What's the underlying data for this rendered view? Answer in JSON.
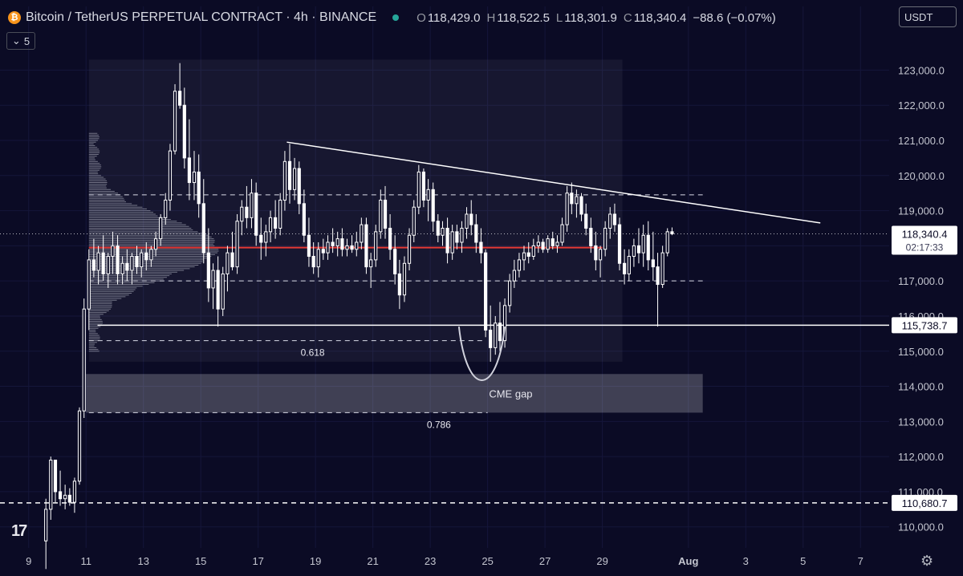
{
  "header": {
    "title": "Bitcoin / TetherUS PERPETUAL CONTRACT · 4h · BINANCE",
    "coin_glyph": "₿",
    "open_label": "O",
    "open": "118,429.0",
    "high_label": "H",
    "high": "118,522.5",
    "low_label": "L",
    "low": "118,301.9",
    "close_label": "C",
    "close": "118,340.4",
    "change": "−88.6 (−0.07%)"
  },
  "currency": "USDT",
  "indicators_count": "5",
  "logo_text": "17",
  "colors": {
    "background": "#0b0b25",
    "candle": "#ffffff",
    "poc_line": "#e53935",
    "live": "#26a69a"
  },
  "chart_data": {
    "type": "candlestick",
    "y_axis": {
      "ylim": [
        109400,
        123900
      ],
      "ticks": [
        123000,
        122000,
        121000,
        120000,
        119000,
        118000,
        117000,
        116000,
        115000,
        114000,
        113000,
        112000,
        111000,
        110000
      ],
      "tick_labels": [
        "123,000.0",
        "122,000.0",
        "121,000.0",
        "120,000.0",
        "119,000.0",
        "118,000.0",
        "117,000.0",
        "116,000.0",
        "115,000.0",
        "114,000.0",
        "113,000.0",
        "112,000.0",
        "111,000.0",
        "110,000.0"
      ]
    },
    "x_axis": {
      "xlim": [
        "Jul 8",
        "Aug 8"
      ],
      "ticks": [
        "Jul 9",
        "Jul 11",
        "Jul 13",
        "Jul 15",
        "Jul 17",
        "Jul 19",
        "Jul 21",
        "Jul 23",
        "Jul 25",
        "Jul 27",
        "Jul 29",
        "Aug 1",
        "Aug 3",
        "Aug 5",
        "Aug 7"
      ],
      "tick_labels": [
        "9",
        "11",
        "13",
        "15",
        "17",
        "19",
        "21",
        "23",
        "25",
        "27",
        "29",
        "Aug",
        "3",
        "5",
        "7"
      ]
    },
    "price_labels": [
      {
        "value": 118340.4,
        "text": "118,340.4",
        "countdown": "02:17:33"
      },
      {
        "value": 115738.7,
        "text": "115,738.7"
      },
      {
        "value": 110680.7,
        "text": "110,680.7"
      }
    ],
    "levels": [
      {
        "value": 117950,
        "style": "poc"
      },
      {
        "value": 119450,
        "style": "dashed"
      },
      {
        "value": 117000,
        "style": "dashed"
      },
      {
        "value": 115738.7,
        "style": "solid"
      },
      {
        "value": 115300,
        "style": "dashed",
        "label": "0.618"
      },
      {
        "value": 113250,
        "style": "dashed",
        "label": "0.786"
      },
      {
        "value": 110680.7,
        "style": "dashed"
      }
    ],
    "trendline": [
      {
        "x": "Jul 18",
        "y": 120950
      },
      {
        "x": "Aug 5.6",
        "y": 118650
      }
    ],
    "range_box": {
      "x0": "Jul 11.1",
      "x1": "Jul 29.7",
      "y0": 114700,
      "y1": 123300
    },
    "zones": [
      {
        "label": "CME gap",
        "x0": "Jul 11",
        "x1": "Aug 1.5",
        "y0": 113250,
        "y1": 114350
      }
    ],
    "curve": {
      "from": "Jul 24",
      "to": "Jul 25.6",
      "top": 115700,
      "bottom": 114350
    },
    "volume_profile": {
      "y_min": 115000,
      "y_max": 121200
    },
    "candles": [
      {
        "t": "Jul 9.6",
        "o": 109600,
        "h": 110800,
        "l": 108800,
        "c": 110500
      },
      {
        "t": "Jul 9.77",
        "o": 110500,
        "h": 112000,
        "l": 110200,
        "c": 111900
      },
      {
        "t": "Jul 9.93",
        "o": 111900,
        "h": 111900,
        "l": 110700,
        "c": 111000
      },
      {
        "t": "Jul 10.1",
        "o": 111000,
        "h": 111600,
        "l": 110600,
        "c": 110800
      },
      {
        "t": "Jul 10.27",
        "o": 110800,
        "h": 111200,
        "l": 110500,
        "c": 110900
      },
      {
        "t": "Jul 10.43",
        "o": 110900,
        "h": 111100,
        "l": 110600,
        "c": 110700
      },
      {
        "t": "Jul 10.6",
        "o": 110700,
        "h": 111400,
        "l": 110400,
        "c": 111300
      },
      {
        "t": "Jul 10.77",
        "o": 111300,
        "h": 113400,
        "l": 111200,
        "c": 113300
      },
      {
        "t": "Jul 10.93",
        "o": 113300,
        "h": 116500,
        "l": 113100,
        "c": 116200
      },
      {
        "t": "Jul 11.1",
        "o": 116200,
        "h": 117900,
        "l": 115600,
        "c": 117600
      },
      {
        "t": "Jul 11.27",
        "o": 117600,
        "h": 118200,
        "l": 117100,
        "c": 117300
      },
      {
        "t": "Jul 11.43",
        "o": 117300,
        "h": 118000,
        "l": 116900,
        "c": 117800
      },
      {
        "t": "Jul 11.6",
        "o": 117800,
        "h": 118300,
        "l": 117000,
        "c": 117200
      },
      {
        "t": "Jul 11.77",
        "o": 117200,
        "h": 117800,
        "l": 116800,
        "c": 117700
      },
      {
        "t": "Jul 11.93",
        "o": 117700,
        "h": 118400,
        "l": 117200,
        "c": 118000
      },
      {
        "t": "Jul 12.1",
        "o": 118000,
        "h": 118300,
        "l": 116900,
        "c": 117200
      },
      {
        "t": "Jul 12.27",
        "o": 117200,
        "h": 117700,
        "l": 116900,
        "c": 117500
      },
      {
        "t": "Jul 12.43",
        "o": 117500,
        "h": 117900,
        "l": 117000,
        "c": 117300
      },
      {
        "t": "Jul 12.6",
        "o": 117300,
        "h": 117800,
        "l": 116900,
        "c": 117700
      },
      {
        "t": "Jul 12.77",
        "o": 117700,
        "h": 118000,
        "l": 117200,
        "c": 117400
      },
      {
        "t": "Jul 12.93",
        "o": 117400,
        "h": 117900,
        "l": 117100,
        "c": 117800
      },
      {
        "t": "Jul 13.1",
        "o": 117800,
        "h": 118100,
        "l": 117300,
        "c": 117600
      },
      {
        "t": "Jul 13.27",
        "o": 117600,
        "h": 118000,
        "l": 117400,
        "c": 117900
      },
      {
        "t": "Jul 13.43",
        "o": 117900,
        "h": 118400,
        "l": 117700,
        "c": 118200
      },
      {
        "t": "Jul 13.6",
        "o": 118200,
        "h": 118900,
        "l": 118000,
        "c": 118800
      },
      {
        "t": "Jul 13.77",
        "o": 118800,
        "h": 119500,
        "l": 118600,
        "c": 119300
      },
      {
        "t": "Jul 13.93",
        "o": 119300,
        "h": 120900,
        "l": 119000,
        "c": 120700
      },
      {
        "t": "Jul 14.1",
        "o": 120700,
        "h": 122600,
        "l": 120600,
        "c": 122400
      },
      {
        "t": "Jul 14.27",
        "o": 122400,
        "h": 123200,
        "l": 121900,
        "c": 122000
      },
      {
        "t": "Jul 14.43",
        "o": 122000,
        "h": 122500,
        "l": 120200,
        "c": 120500
      },
      {
        "t": "Jul 14.6",
        "o": 120500,
        "h": 121600,
        "l": 119300,
        "c": 119800
      },
      {
        "t": "Jul 14.77",
        "o": 119800,
        "h": 120700,
        "l": 119300,
        "c": 120100
      },
      {
        "t": "Jul 14.93",
        "o": 120100,
        "h": 120600,
        "l": 118800,
        "c": 119200
      },
      {
        "t": "Jul 15.1",
        "o": 119200,
        "h": 119900,
        "l": 117500,
        "c": 117800
      },
      {
        "t": "Jul 15.27",
        "o": 117800,
        "h": 118500,
        "l": 116400,
        "c": 116800
      },
      {
        "t": "Jul 15.43",
        "o": 116800,
        "h": 117500,
        "l": 116200,
        "c": 117300
      },
      {
        "t": "Jul 15.6",
        "o": 117300,
        "h": 117700,
        "l": 115700,
        "c": 116200
      },
      {
        "t": "Jul 15.77",
        "o": 116200,
        "h": 117400,
        "l": 116000,
        "c": 117200
      },
      {
        "t": "Jul 15.93",
        "o": 117200,
        "h": 118000,
        "l": 116700,
        "c": 117800
      },
      {
        "t": "Jul 16.1",
        "o": 117800,
        "h": 118400,
        "l": 117300,
        "c": 117400
      },
      {
        "t": "Jul 16.27",
        "o": 117400,
        "h": 118900,
        "l": 117200,
        "c": 118700
      },
      {
        "t": "Jul 16.43",
        "o": 118700,
        "h": 119300,
        "l": 118300,
        "c": 119100
      },
      {
        "t": "Jul 16.6",
        "o": 119100,
        "h": 119700,
        "l": 118500,
        "c": 118800
      },
      {
        "t": "Jul 16.77",
        "o": 118800,
        "h": 119900,
        "l": 118500,
        "c": 119500
      },
      {
        "t": "Jul 16.93",
        "o": 119500,
        "h": 119800,
        "l": 118000,
        "c": 118300
      },
      {
        "t": "Jul 17.1",
        "o": 118300,
        "h": 118800,
        "l": 117600,
        "c": 118100
      },
      {
        "t": "Jul 17.27",
        "o": 118100,
        "h": 118600,
        "l": 117700,
        "c": 118400
      },
      {
        "t": "Jul 17.43",
        "o": 118400,
        "h": 119000,
        "l": 118100,
        "c": 118800
      },
      {
        "t": "Jul 17.6",
        "o": 118800,
        "h": 119300,
        "l": 118200,
        "c": 118500
      },
      {
        "t": "Jul 17.77",
        "o": 118500,
        "h": 119500,
        "l": 118300,
        "c": 119300
      },
      {
        "t": "Jul 17.93",
        "o": 119300,
        "h": 120700,
        "l": 119000,
        "c": 120400
      },
      {
        "t": "Jul 18.1",
        "o": 120400,
        "h": 120900,
        "l": 119200,
        "c": 119600
      },
      {
        "t": "Jul 18.27",
        "o": 119600,
        "h": 120500,
        "l": 119300,
        "c": 120200
      },
      {
        "t": "Jul 18.43",
        "o": 120200,
        "h": 120400,
        "l": 118900,
        "c": 119200
      },
      {
        "t": "Jul 18.6",
        "o": 119200,
        "h": 119600,
        "l": 118100,
        "c": 118300
      },
      {
        "t": "Jul 18.77",
        "o": 118300,
        "h": 118800,
        "l": 117400,
        "c": 117700
      },
      {
        "t": "Jul 18.93",
        "o": 117700,
        "h": 118100,
        "l": 117200,
        "c": 117400
      },
      {
        "t": "Jul 19.1",
        "o": 117400,
        "h": 118100,
        "l": 117100,
        "c": 117900
      },
      {
        "t": "Jul 19.27",
        "o": 117900,
        "h": 118200,
        "l": 117600,
        "c": 117800
      },
      {
        "t": "Jul 19.43",
        "o": 117800,
        "h": 118300,
        "l": 117600,
        "c": 118100
      },
      {
        "t": "Jul 19.6",
        "o": 118100,
        "h": 118500,
        "l": 117800,
        "c": 118000
      },
      {
        "t": "Jul 19.77",
        "o": 118000,
        "h": 118400,
        "l": 117700,
        "c": 118200
      },
      {
        "t": "Jul 19.93",
        "o": 118200,
        "h": 118500,
        "l": 117700,
        "c": 117900
      },
      {
        "t": "Jul 20.1",
        "o": 117900,
        "h": 118200,
        "l": 117700,
        "c": 118000
      },
      {
        "t": "Jul 20.27",
        "o": 118000,
        "h": 118300,
        "l": 117800,
        "c": 117900
      },
      {
        "t": "Jul 20.43",
        "o": 117900,
        "h": 118400,
        "l": 117700,
        "c": 118100
      },
      {
        "t": "Jul 20.6",
        "o": 118100,
        "h": 118800,
        "l": 117900,
        "c": 118600
      },
      {
        "t": "Jul 20.77",
        "o": 118600,
        "h": 118800,
        "l": 117200,
        "c": 117400
      },
      {
        "t": "Jul 20.93",
        "o": 117400,
        "h": 117800,
        "l": 116800,
        "c": 117600
      },
      {
        "t": "Jul 21.1",
        "o": 117600,
        "h": 118600,
        "l": 117400,
        "c": 118400
      },
      {
        "t": "Jul 21.27",
        "o": 118400,
        "h": 119600,
        "l": 118200,
        "c": 119300
      },
      {
        "t": "Jul 21.43",
        "o": 119300,
        "h": 119700,
        "l": 118200,
        "c": 118500
      },
      {
        "t": "Jul 21.6",
        "o": 118500,
        "h": 118900,
        "l": 117600,
        "c": 117900
      },
      {
        "t": "Jul 21.77",
        "o": 117900,
        "h": 118300,
        "l": 116900,
        "c": 117200
      },
      {
        "t": "Jul 21.93",
        "o": 117200,
        "h": 117600,
        "l": 116200,
        "c": 116600
      },
      {
        "t": "Jul 22.1",
        "o": 116600,
        "h": 117700,
        "l": 116400,
        "c": 117500
      },
      {
        "t": "Jul 22.27",
        "o": 117500,
        "h": 118500,
        "l": 117300,
        "c": 118300
      },
      {
        "t": "Jul 22.43",
        "o": 118300,
        "h": 119300,
        "l": 118100,
        "c": 119100
      },
      {
        "t": "Jul 22.6",
        "o": 119100,
        "h": 120300,
        "l": 118900,
        "c": 120100
      },
      {
        "t": "Jul 22.77",
        "o": 120100,
        "h": 120200,
        "l": 119100,
        "c": 119300
      },
      {
        "t": "Jul 22.93",
        "o": 119300,
        "h": 119900,
        "l": 118700,
        "c": 119600
      },
      {
        "t": "Jul 23.1",
        "o": 119600,
        "h": 119800,
        "l": 118400,
        "c": 118700
      },
      {
        "t": "Jul 23.27",
        "o": 118700,
        "h": 118900,
        "l": 118100,
        "c": 118300
      },
      {
        "t": "Jul 23.43",
        "o": 118300,
        "h": 118700,
        "l": 118000,
        "c": 118500
      },
      {
        "t": "Jul 23.6",
        "o": 118500,
        "h": 118800,
        "l": 117500,
        "c": 117800
      },
      {
        "t": "Jul 23.77",
        "o": 117800,
        "h": 118600,
        "l": 117600,
        "c": 118400
      },
      {
        "t": "Jul 23.93",
        "o": 118400,
        "h": 118600,
        "l": 117900,
        "c": 118100
      },
      {
        "t": "Jul 24.1",
        "o": 118100,
        "h": 118700,
        "l": 117800,
        "c": 118500
      },
      {
        "t": "Jul 24.27",
        "o": 118500,
        "h": 119100,
        "l": 118200,
        "c": 118900
      },
      {
        "t": "Jul 24.43",
        "o": 118900,
        "h": 119300,
        "l": 118300,
        "c": 118600
      },
      {
        "t": "Jul 24.6",
        "o": 118600,
        "h": 118900,
        "l": 117800,
        "c": 118100
      },
      {
        "t": "Jul 24.77",
        "o": 118100,
        "h": 118500,
        "l": 117500,
        "c": 117800
      },
      {
        "t": "Jul 24.93",
        "o": 117800,
        "h": 117900,
        "l": 115400,
        "c": 115600
      },
      {
        "t": "Jul 25.1",
        "o": 115600,
        "h": 116300,
        "l": 114700,
        "c": 115100
      },
      {
        "t": "Jul 25.27",
        "o": 115100,
        "h": 116000,
        "l": 114900,
        "c": 115800
      },
      {
        "t": "Jul 25.43",
        "o": 115800,
        "h": 116400,
        "l": 115000,
        "c": 115300
      },
      {
        "t": "Jul 25.6",
        "o": 115300,
        "h": 116500,
        "l": 115100,
        "c": 116300
      },
      {
        "t": "Jul 25.77",
        "o": 116300,
        "h": 117200,
        "l": 116100,
        "c": 117000
      },
      {
        "t": "Jul 25.93",
        "o": 117000,
        "h": 117600,
        "l": 116800,
        "c": 117300
      },
      {
        "t": "Jul 26.1",
        "o": 117300,
        "h": 117800,
        "l": 117100,
        "c": 117600
      },
      {
        "t": "Jul 26.27",
        "o": 117600,
        "h": 118000,
        "l": 117300,
        "c": 117800
      },
      {
        "t": "Jul 26.43",
        "o": 117800,
        "h": 118100,
        "l": 117500,
        "c": 117700
      },
      {
        "t": "Jul 26.6",
        "o": 117700,
        "h": 118200,
        "l": 117600,
        "c": 118000
      },
      {
        "t": "Jul 26.77",
        "o": 118000,
        "h": 118300,
        "l": 117800,
        "c": 118100
      },
      {
        "t": "Jul 26.93",
        "o": 118100,
        "h": 118200,
        "l": 117800,
        "c": 117900
      },
      {
        "t": "Jul 27.1",
        "o": 117900,
        "h": 118300,
        "l": 117800,
        "c": 118200
      },
      {
        "t": "Jul 27.27",
        "o": 118200,
        "h": 118400,
        "l": 117900,
        "c": 118000
      },
      {
        "t": "Jul 27.43",
        "o": 118000,
        "h": 118300,
        "l": 117800,
        "c": 118100
      },
      {
        "t": "Jul 27.6",
        "o": 118100,
        "h": 118800,
        "l": 118000,
        "c": 118600
      },
      {
        "t": "Jul 27.77",
        "o": 118600,
        "h": 119700,
        "l": 118400,
        "c": 119500
      },
      {
        "t": "Jul 27.93",
        "o": 119500,
        "h": 119800,
        "l": 118900,
        "c": 119200
      },
      {
        "t": "Jul 28.1",
        "o": 119200,
        "h": 119600,
        "l": 118800,
        "c": 119400
      },
      {
        "t": "Jul 28.27",
        "o": 119400,
        "h": 119500,
        "l": 118700,
        "c": 118900
      },
      {
        "t": "Jul 28.43",
        "o": 118900,
        "h": 119200,
        "l": 118300,
        "c": 118500
      },
      {
        "t": "Jul 28.6",
        "o": 118500,
        "h": 118800,
        "l": 117800,
        "c": 118000
      },
      {
        "t": "Jul 28.77",
        "o": 118000,
        "h": 118400,
        "l": 117300,
        "c": 117600
      },
      {
        "t": "Jul 28.93",
        "o": 117600,
        "h": 118000,
        "l": 117100,
        "c": 117900
      },
      {
        "t": "Jul 29.1",
        "o": 117900,
        "h": 118700,
        "l": 117700,
        "c": 118500
      },
      {
        "t": "Jul 29.27",
        "o": 118500,
        "h": 119100,
        "l": 118200,
        "c": 118900
      },
      {
        "t": "Jul 29.43",
        "o": 118900,
        "h": 119200,
        "l": 118400,
        "c": 118600
      },
      {
        "t": "Jul 29.6",
        "o": 118600,
        "h": 118800,
        "l": 117300,
        "c": 117500
      },
      {
        "t": "Jul 29.77",
        "o": 117500,
        "h": 117900,
        "l": 116900,
        "c": 117200
      },
      {
        "t": "Jul 29.93",
        "o": 117200,
        "h": 117900,
        "l": 117000,
        "c": 117700
      },
      {
        "t": "Jul 30.1",
        "o": 117700,
        "h": 118200,
        "l": 117400,
        "c": 118000
      },
      {
        "t": "Jul 30.27",
        "o": 118000,
        "h": 118500,
        "l": 117500,
        "c": 117800
      },
      {
        "t": "Jul 30.43",
        "o": 117800,
        "h": 118600,
        "l": 117400,
        "c": 118300
      },
      {
        "t": "Jul 30.6",
        "o": 118300,
        "h": 118700,
        "l": 117300,
        "c": 117600
      },
      {
        "t": "Jul 30.77",
        "o": 117600,
        "h": 118400,
        "l": 117000,
        "c": 117400
      },
      {
        "t": "Jul 30.93",
        "o": 117400,
        "h": 117800,
        "l": 115700,
        "c": 116900
      },
      {
        "t": "Jul 31.1",
        "o": 116900,
        "h": 118000,
        "l": 116800,
        "c": 117800
      },
      {
        "t": "Jul 31.27",
        "o": 117800,
        "h": 118500,
        "l": 117700,
        "c": 118400
      },
      {
        "t": "Jul 31.43",
        "o": 118400,
        "h": 118522.5,
        "l": 118301.9,
        "c": 118340.4
      }
    ]
  }
}
